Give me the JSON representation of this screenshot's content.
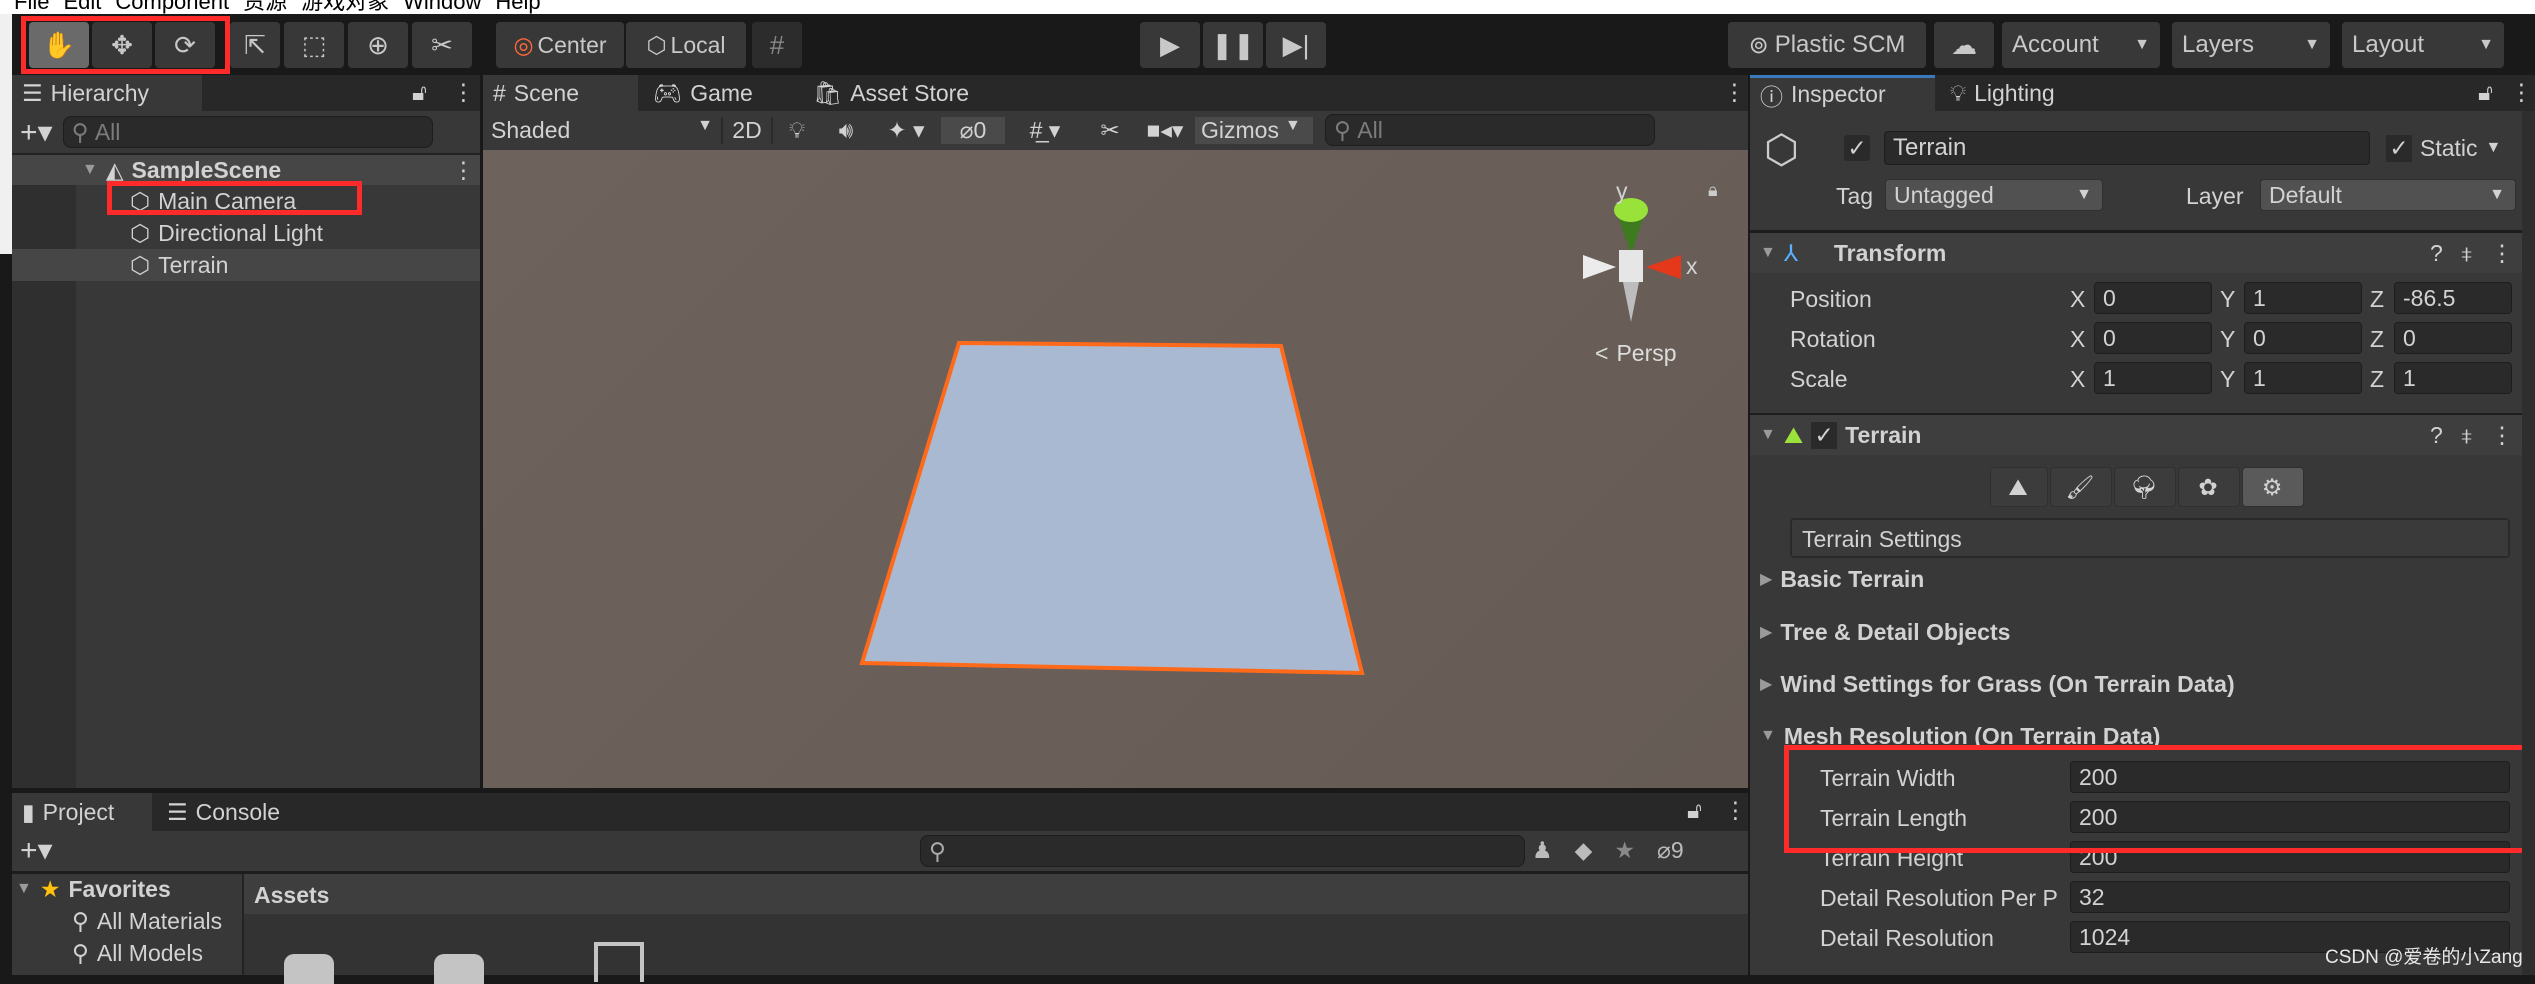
{
  "menubar": {
    "items": [
      "File",
      "Edit",
      "Component",
      "资源",
      "游戏对象",
      "Window",
      "Help"
    ]
  },
  "toolbar": {
    "tools": [
      "hand-tool",
      "move-tool",
      "rotate-tool",
      "scale-tool",
      "rect-tool",
      "transform-tool",
      "custom-tool"
    ],
    "pivot": "Center",
    "space": "Local",
    "plastic": "Plastic SCM",
    "account": "Account",
    "layers": "Layers",
    "layout": "Layout"
  },
  "hierarchy": {
    "title": "Hierarchy",
    "search_placeholder": "All",
    "scene": "SampleScene",
    "items": [
      "Main Camera",
      "Directional Light",
      "Terrain"
    ]
  },
  "scene": {
    "tabs": [
      "Scene",
      "Game",
      "Asset Store"
    ],
    "shading": "Shaded",
    "mode2d": "2D",
    "hidden_count": "0",
    "gizmos": "Gizmos",
    "search_placeholder": "All",
    "persp": "Persp",
    "axis_y": "y",
    "axis_x": "x",
    "selection_color": "#ff6a1a",
    "terrain_color": "#a9b9d2"
  },
  "inspector": {
    "tabs": [
      "Inspector",
      "Lighting"
    ],
    "object_name": "Terrain",
    "static_label": "Static",
    "tag_label": "Tag",
    "tag_value": "Untagged",
    "layer_label": "Layer",
    "layer_value": "Default",
    "transform": {
      "title": "Transform",
      "rows": [
        {
          "label": "Position",
          "x": "0",
          "y": "1",
          "z": "-86.5"
        },
        {
          "label": "Rotation",
          "x": "0",
          "y": "0",
          "z": "0"
        },
        {
          "label": "Scale",
          "x": "1",
          "y": "1",
          "z": "1"
        }
      ],
      "axes": [
        "X",
        "Y",
        "Z"
      ]
    },
    "terrain": {
      "title": "Terrain",
      "settings_label": "Terrain Settings",
      "sections": [
        "Basic Terrain",
        "Tree & Detail Objects",
        "Wind Settings for Grass (On Terrain Data)",
        "Mesh Resolution (On Terrain Data)"
      ],
      "fields": [
        {
          "label": "Terrain Width",
          "value": "200"
        },
        {
          "label": "Terrain Length",
          "value": "200"
        },
        {
          "label": "Terrain Height",
          "value": "200"
        },
        {
          "label": "Detail Resolution Per P",
          "value": "32"
        },
        {
          "label": "Detail Resolution",
          "value": "1024"
        }
      ]
    }
  },
  "project": {
    "tabs": [
      "Project",
      "Console"
    ],
    "hidden_count": "9",
    "favorites": "Favorites",
    "fav_items": [
      "All Materials",
      "All Models"
    ],
    "assets_header": "Assets"
  },
  "watermark": "CSDN @爱卷的小Zang",
  "colors": {
    "highlight": "#ff2a2a",
    "accent_tab": "#3a79bb"
  }
}
